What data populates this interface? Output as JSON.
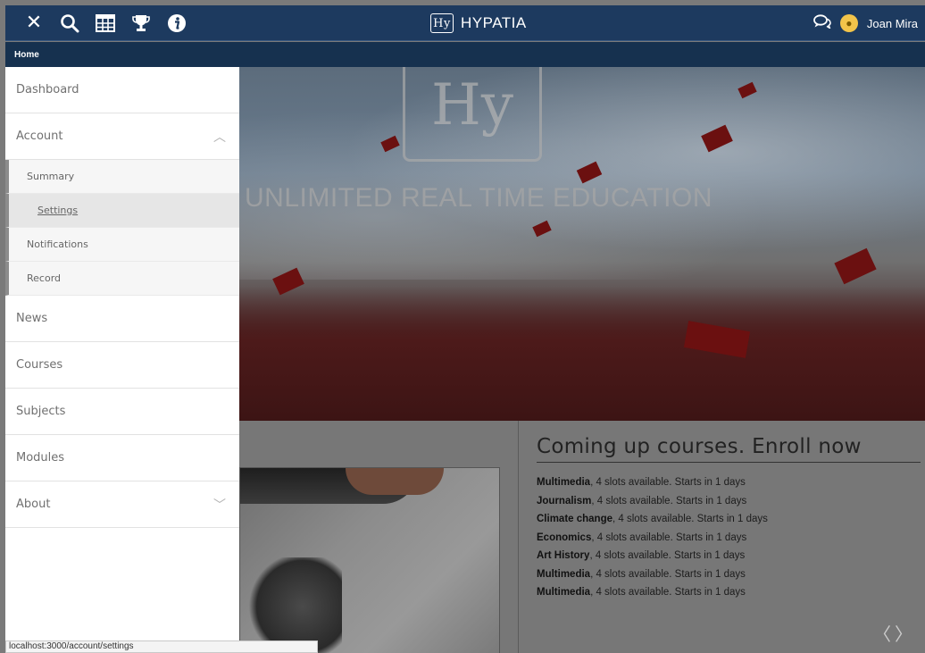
{
  "topbar": {
    "icons": [
      "close-icon",
      "search-icon",
      "grid-icon",
      "trophy-icon",
      "info-icon"
    ],
    "brand": "HYPATIA",
    "brand_logo": "Hy",
    "user_name": "Joan Mira"
  },
  "breadcrumb": {
    "home": "Home"
  },
  "sidebar": {
    "items": [
      {
        "label": "Dashboard"
      },
      {
        "label": "Account",
        "expanded": true
      },
      {
        "label": "News"
      },
      {
        "label": "Courses"
      },
      {
        "label": "Subjects"
      },
      {
        "label": "Modules"
      },
      {
        "label": "About",
        "expanded": false
      }
    ],
    "account_sub": [
      {
        "label": "Summary"
      },
      {
        "label": "Settings",
        "active": true
      },
      {
        "label": "Notifications"
      },
      {
        "label": "Record"
      }
    ]
  },
  "hero": {
    "emblem": "Hy",
    "tagline": "UNLIMITED REAL TIME EDUCATION"
  },
  "courses": {
    "title": "Coming up courses. Enroll now",
    "list": [
      {
        "name": "Multimedia",
        "detail": ", 4 slots available. Starts in 1 days"
      },
      {
        "name": "Journalism",
        "detail": ", 4 slots available. Starts in 1 days"
      },
      {
        "name": "Climate change",
        "detail": ", 4 slots available. Starts in 1 days"
      },
      {
        "name": "Economics",
        "detail": ", 4 slots available. Starts in 1 days"
      },
      {
        "name": "Art History",
        "detail": ", 4 slots available. Starts in 1 days"
      },
      {
        "name": "Multimedia",
        "detail": ", 4 slots available. Starts in 1 days"
      },
      {
        "name": "Multimedia",
        "detail": ", 4 slots available. Starts in 1 days"
      }
    ]
  },
  "statusbar": {
    "url": "localhost:3000/account/settings"
  },
  "colors": {
    "header": "#1d3a5f",
    "breadcrumb": "#16314f",
    "sidebar_accent": "#8c8c8c"
  }
}
